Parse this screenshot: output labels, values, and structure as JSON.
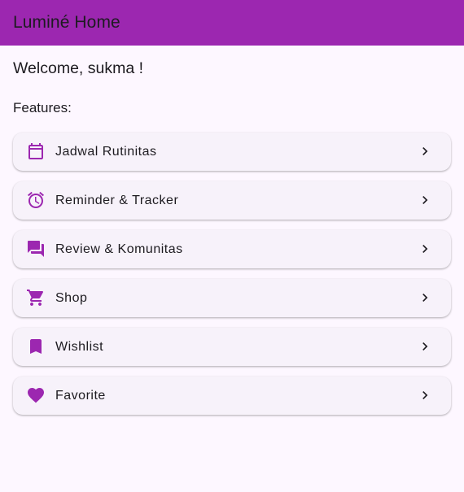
{
  "appbar": {
    "title": "Luminé Home",
    "color": "#9c27b0"
  },
  "welcome": "Welcome, sukma !",
  "features_label": "Features:",
  "accent_color": "#9c27b0",
  "features": [
    {
      "label": "Jadwal Rutinitas",
      "icon": "calendar-icon"
    },
    {
      "label": "Reminder & Tracker",
      "icon": "alarm-icon"
    },
    {
      "label": "Review & Komunitas",
      "icon": "forum-icon"
    },
    {
      "label": "Shop",
      "icon": "cart-icon"
    },
    {
      "label": "Wishlist",
      "icon": "bookmark-icon"
    },
    {
      "label": "Favorite",
      "icon": "heart-icon"
    }
  ]
}
